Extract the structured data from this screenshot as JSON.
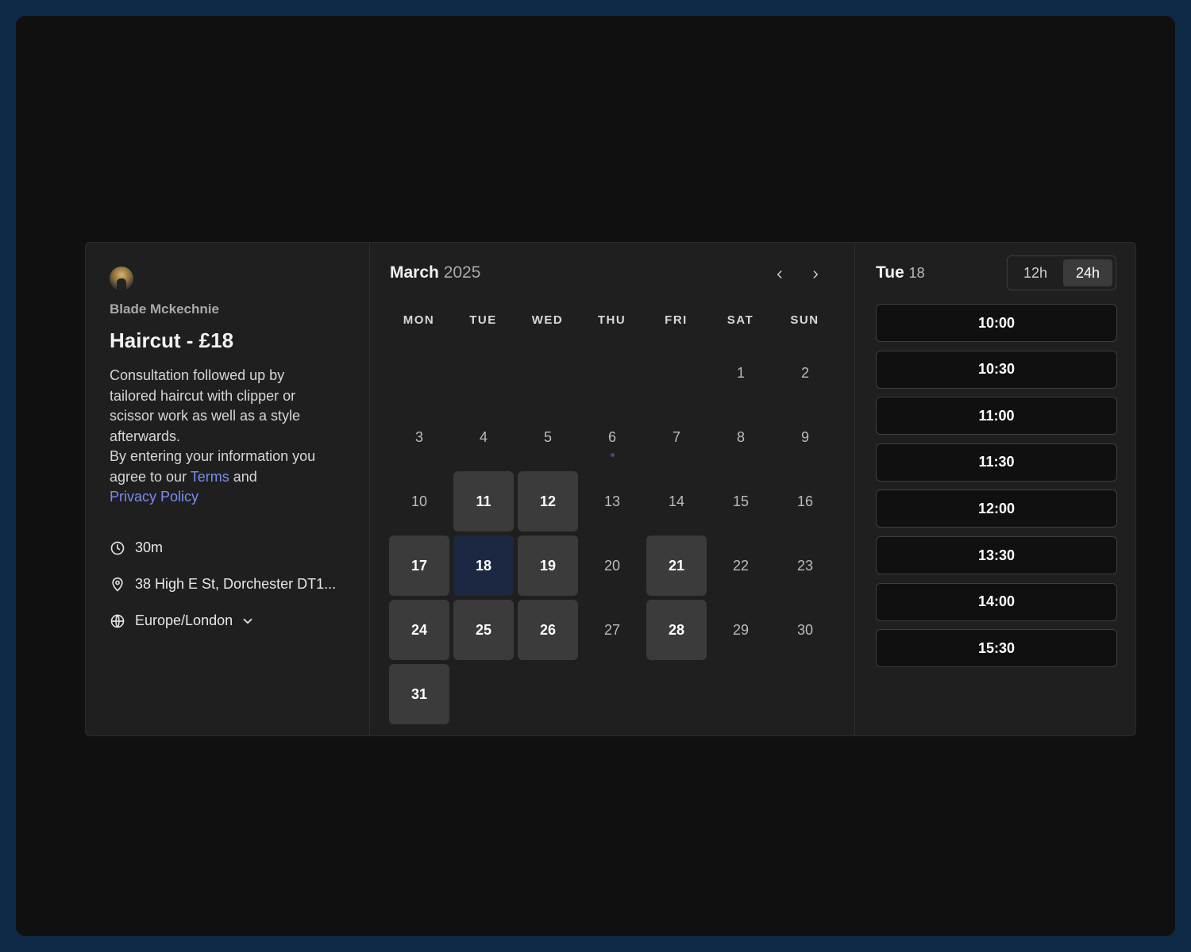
{
  "event": {
    "owner": "Blade Mckechnie",
    "title": "Haircut - £18",
    "description_line": "Consultation followed up by tailored haircut with clipper or scissor work as well as a style afterwards.",
    "terms_prefix": "By entering your information you agree to our ",
    "terms_link": "Terms",
    "terms_and": " and",
    "privacy_link": "Privacy Policy",
    "duration": "30m",
    "location": "38 High E St, Dorchester DT1...",
    "timezone": "Europe/London",
    "link_color": "#7b8cf2"
  },
  "calendar": {
    "month": "March",
    "year": "2025",
    "weekdays": [
      "MON",
      "TUE",
      "WED",
      "THU",
      "FRI",
      "SAT",
      "SUN"
    ],
    "days": [
      {
        "label": "1",
        "state": "unavailable"
      },
      {
        "label": "2",
        "state": "unavailable"
      },
      {
        "label": "3",
        "state": "unavailable"
      },
      {
        "label": "4",
        "state": "unavailable"
      },
      {
        "label": "5",
        "state": "unavailable"
      },
      {
        "label": "6",
        "state": "today"
      },
      {
        "label": "7",
        "state": "unavailable"
      },
      {
        "label": "8",
        "state": "unavailable"
      },
      {
        "label": "9",
        "state": "unavailable"
      },
      {
        "label": "10",
        "state": "unavailable"
      },
      {
        "label": "11",
        "state": "available"
      },
      {
        "label": "12",
        "state": "available"
      },
      {
        "label": "13",
        "state": "unavailable"
      },
      {
        "label": "14",
        "state": "unavailable"
      },
      {
        "label": "15",
        "state": "unavailable"
      },
      {
        "label": "16",
        "state": "unavailable"
      },
      {
        "label": "17",
        "state": "available"
      },
      {
        "label": "18",
        "state": "selected"
      },
      {
        "label": "19",
        "state": "available"
      },
      {
        "label": "20",
        "state": "unavailable"
      },
      {
        "label": "21",
        "state": "available"
      },
      {
        "label": "22",
        "state": "unavailable"
      },
      {
        "label": "23",
        "state": "unavailable"
      },
      {
        "label": "24",
        "state": "available"
      },
      {
        "label": "25",
        "state": "available"
      },
      {
        "label": "26",
        "state": "available"
      },
      {
        "label": "27",
        "state": "unavailable"
      },
      {
        "label": "28",
        "state": "available"
      },
      {
        "label": "29",
        "state": "unavailable"
      },
      {
        "label": "30",
        "state": "unavailable"
      },
      {
        "label": "31",
        "state": "available"
      }
    ],
    "selected_color": "#1c2742",
    "available_color": "#3b3b3b"
  },
  "slots": {
    "day_name": "Tue",
    "day_number": "18",
    "format_options": [
      "12h",
      "24h"
    ],
    "selected_format": "24h",
    "times": [
      "10:00",
      "10:30",
      "11:00",
      "11:30",
      "12:00",
      "13:30",
      "14:00",
      "15:30"
    ]
  }
}
